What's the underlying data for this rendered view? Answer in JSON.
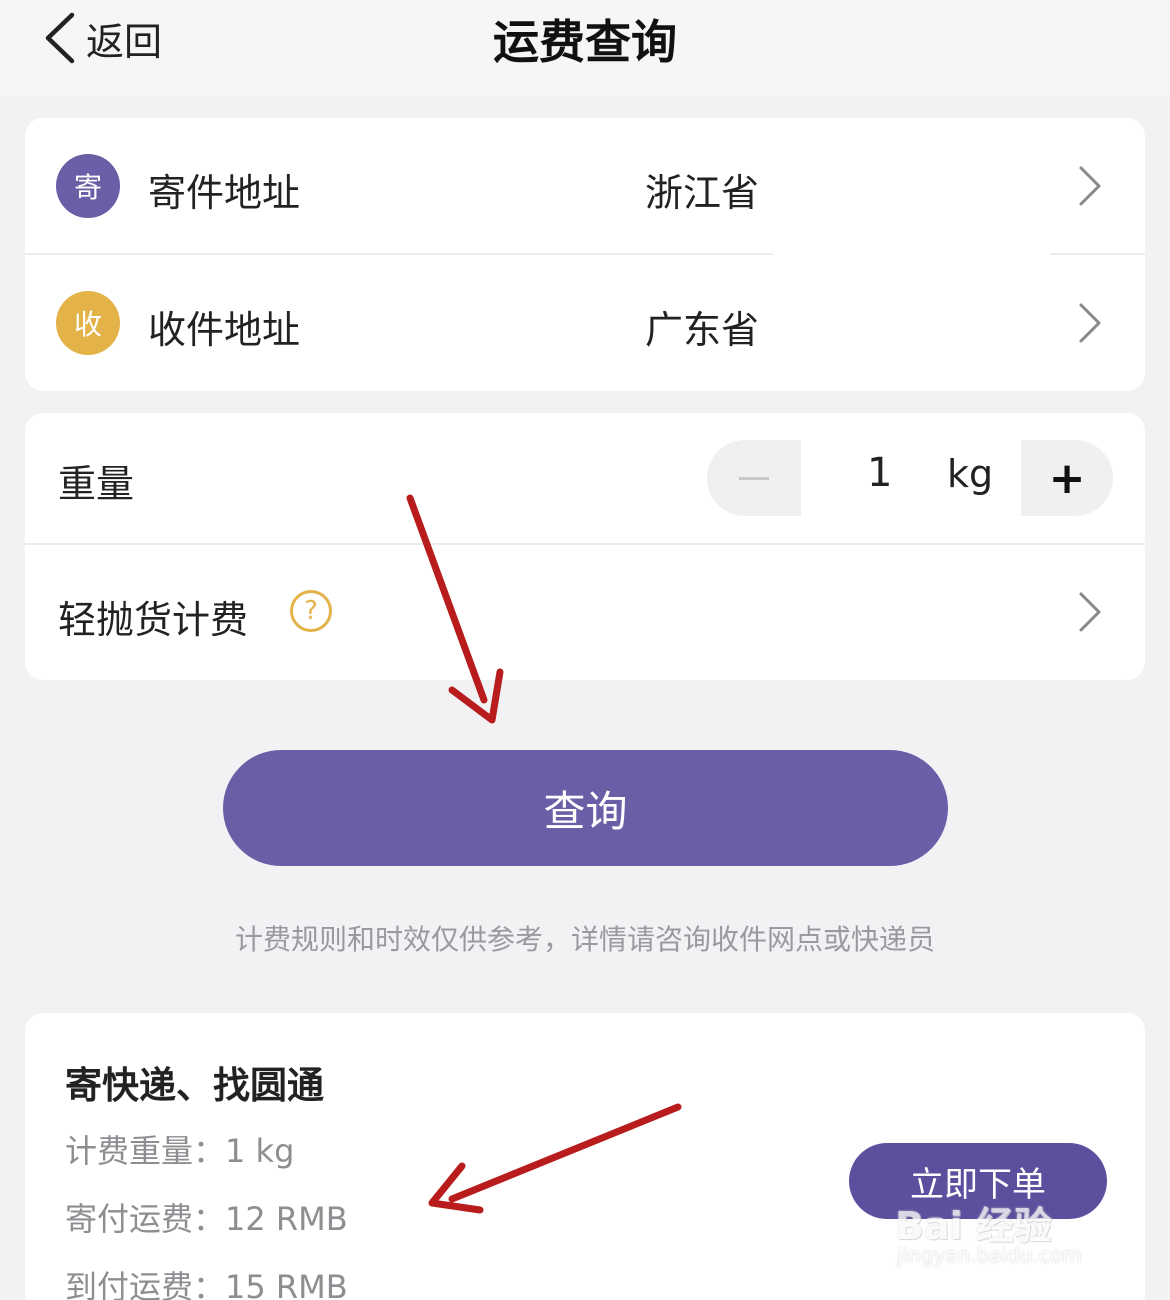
{
  "header": {
    "back_label": "返回",
    "title": "运费查询"
  },
  "address": {
    "sender": {
      "badge": "寄",
      "label": "寄件地址",
      "value": "浙江省",
      "color": "#6b5ea7"
    },
    "receiver": {
      "badge": "收",
      "label": "收件地址",
      "value": "广东省",
      "color": "#e3b34a"
    }
  },
  "weight": {
    "label": "重量",
    "value": "1",
    "unit": "kg",
    "minus": "−",
    "plus": "+"
  },
  "light_cargo": {
    "label": "轻抛货计费",
    "help_icon": "?"
  },
  "query_button": "查询",
  "note": "计费规则和时效仅供参考，详情请咨询收件网点或快递员",
  "result": {
    "title": "寄快递、找圆通",
    "billing_weight": "计费重量：1 kg",
    "prepaid": "寄付运费：12 RMB",
    "cod": "到付运费：15 RMB",
    "order_button": "立即下单"
  },
  "watermark": {
    "logo": "Bai 经验",
    "url": "jingyan.baidu.com"
  },
  "colors": {
    "primary": "#6b5ea7",
    "accent": "#e3b34a",
    "annotation": "#b81c1c"
  }
}
